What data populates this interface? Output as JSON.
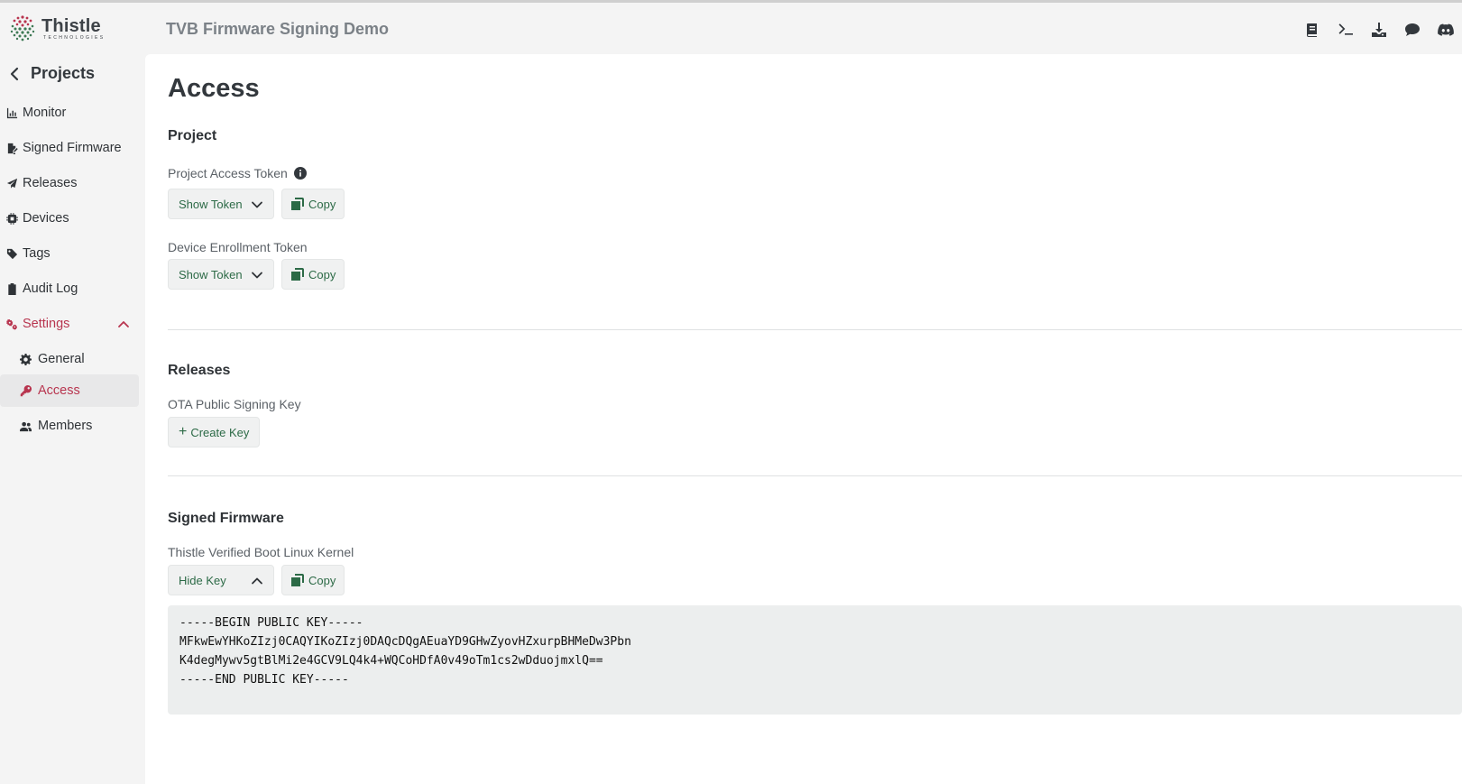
{
  "brand": {
    "name": "Thistle",
    "subtitle": "TECHNOLOGIES"
  },
  "header": {
    "app_title": "TVB Firmware Signing Demo",
    "icons": [
      "book-icon",
      "terminal-icon",
      "download-icon",
      "chat-icon",
      "discord-icon"
    ]
  },
  "sidebar": {
    "back_label": "Projects",
    "items": [
      {
        "label": "Monitor",
        "icon": "chart-icon"
      },
      {
        "label": "Signed Firmware",
        "icon": "file-signature-icon"
      },
      {
        "label": "Releases",
        "icon": "paper-plane-icon"
      },
      {
        "label": "Devices",
        "icon": "chip-icon"
      },
      {
        "label": "Tags",
        "icon": "tag-icon"
      },
      {
        "label": "Audit Log",
        "icon": "clipboard-icon"
      },
      {
        "label": "Settings",
        "icon": "gears-icon",
        "expanded": true
      },
      {
        "label": "General",
        "icon": "gear-icon"
      },
      {
        "label": "Access",
        "icon": "key-icon",
        "active": true
      },
      {
        "label": "Members",
        "icon": "users-icon"
      }
    ]
  },
  "main": {
    "title": "Access",
    "project": {
      "heading": "Project",
      "access_token_label": "Project Access Token",
      "enrollment_token_label": "Device Enrollment Token",
      "show_token_label": "Show Token",
      "copy_label": "Copy"
    },
    "releases": {
      "heading": "Releases",
      "ota_label": "OTA Public Signing Key",
      "create_key_label": "Create Key"
    },
    "signed_firmware": {
      "heading": "Signed Firmware",
      "kernel_label": "Thistle Verified Boot Linux Kernel",
      "hide_key_label": "Hide Key",
      "copy_label": "Copy",
      "public_key": "-----BEGIN PUBLIC KEY-----\nMFkwEwYHKoZIzj0CAQYIKoZIzj0DAQcDQgAEuaYD9GHwZyovHZxurpBHMeDw3Pbn\nK4degMywv5gtBlMi2e4GCV9LQ4k4+WQCoHDfA0v49oTm1cs2wDduojmxlQ==\n-----END PUBLIC KEY-----"
    }
  },
  "colors": {
    "accent": "#b8354f",
    "button_text": "#2c6a46"
  }
}
